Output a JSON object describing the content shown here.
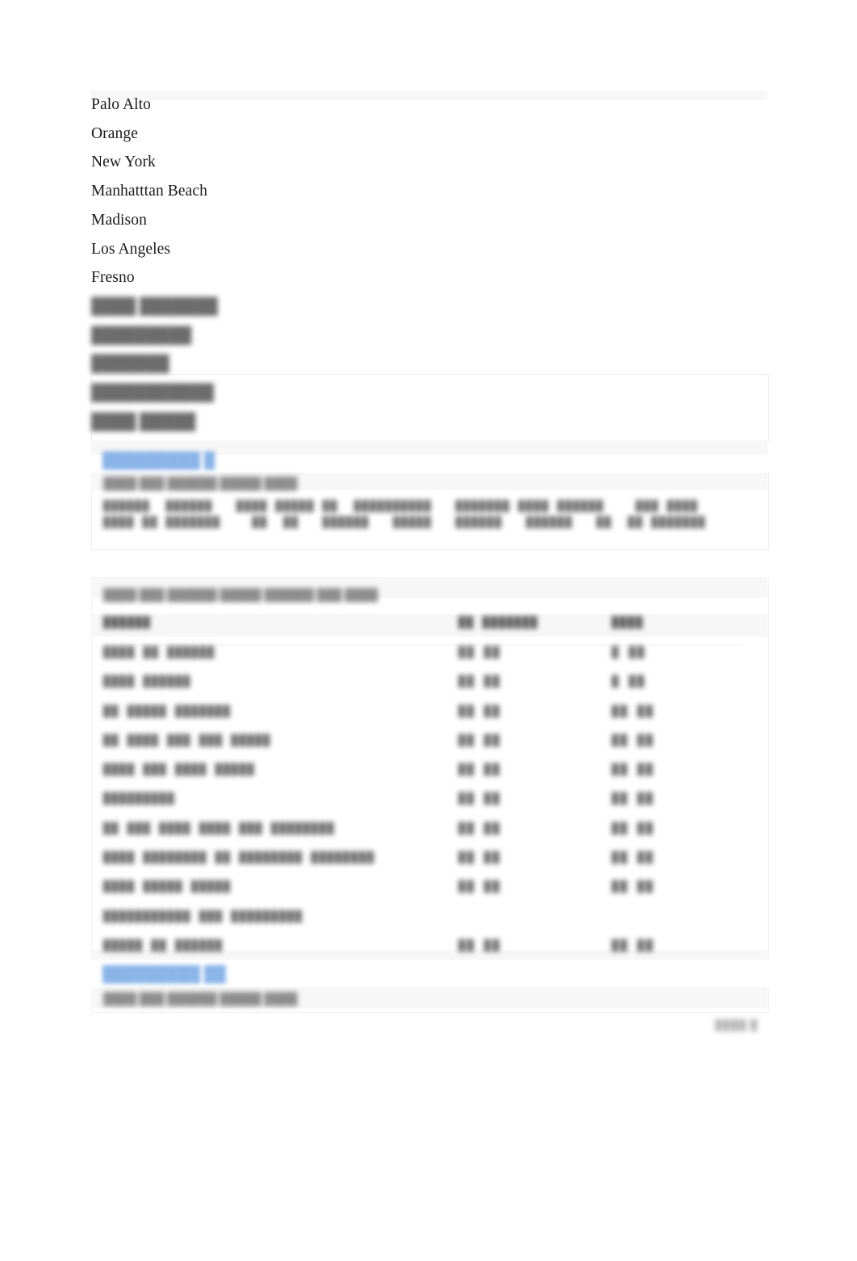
{
  "document": {
    "page_label": "Page 1"
  },
  "city_list": {
    "visible_items": [
      "Palo Alto",
      "Orange",
      "New York",
      "Manhatttan Beach",
      "Madison",
      "Los Angeles",
      "Fresno"
    ],
    "redacted_items": [
      "████ ███████",
      "█████████",
      "███████",
      "███████████",
      "████ █████"
    ]
  },
  "section_one": {
    "heading": "█████████ █",
    "sub_label": "████ ███ ██████ █████ ████",
    "code_line_1": "██████  ██████   ████ █████ ██  ██████████   ███████ ████ ██████    ███ ████",
    "code_line_2": "████ ██ ███████    ██  ██   ██████   █████   ██████   ██████   ██  ██ ███████"
  },
  "section_two": {
    "sub_label": "████ ███ ██████ █████ ██████ ███ ████"
  },
  "section_three": {
    "heading": "█████████ ██",
    "sub_label": "████ ███ ██████ █████ ████"
  },
  "table": {
    "headers": [
      "██████",
      "██ ███████",
      "████"
    ],
    "rows": [
      {
        "name": "████  ██   ██████",
        "mid": "██ ██",
        "right": "█ ██"
      },
      {
        "name": "████ ██████",
        "mid": "██ ██",
        "right": "█ ██"
      },
      {
        "name": "██ █████ ███████",
        "mid": "██ ██",
        "right": "██ ██"
      },
      {
        "name": "██ ████ ███  ███ █████",
        "mid": "██ ██",
        "right": "██ ██"
      },
      {
        "name": "████ ███ ████ █████",
        "mid": "██ ██",
        "right": "██ ██"
      },
      {
        "name": "█████████",
        "mid": "██ ██",
        "right": "██ ██"
      },
      {
        "name": "██ ███ ████ ████ ███ ████████",
        "mid": "██ ██",
        "right": "██ ██"
      },
      {
        "name": "████ ████████  ██  ████████ ████████",
        "mid": "██ ██",
        "right": "██ ██"
      },
      {
        "name": "████ █████ █████",
        "mid": "██ ██",
        "right": "██ ██"
      },
      {
        "name": "███████████ ███ █████████",
        "mid": "",
        "right": ""
      },
      {
        "name": "█████  ██  ██████",
        "mid": "██ ██",
        "right": "██ ██"
      }
    ]
  },
  "footer": {
    "page_number": "████ █"
  },
  "colors": {
    "page_background": "#ffffff",
    "body_text": "#1b1b1b",
    "redacted_text": "#6e6e6e",
    "heading_blue": "#8ab4e8",
    "rule": "#ededed",
    "band": "#f7f7f7"
  }
}
